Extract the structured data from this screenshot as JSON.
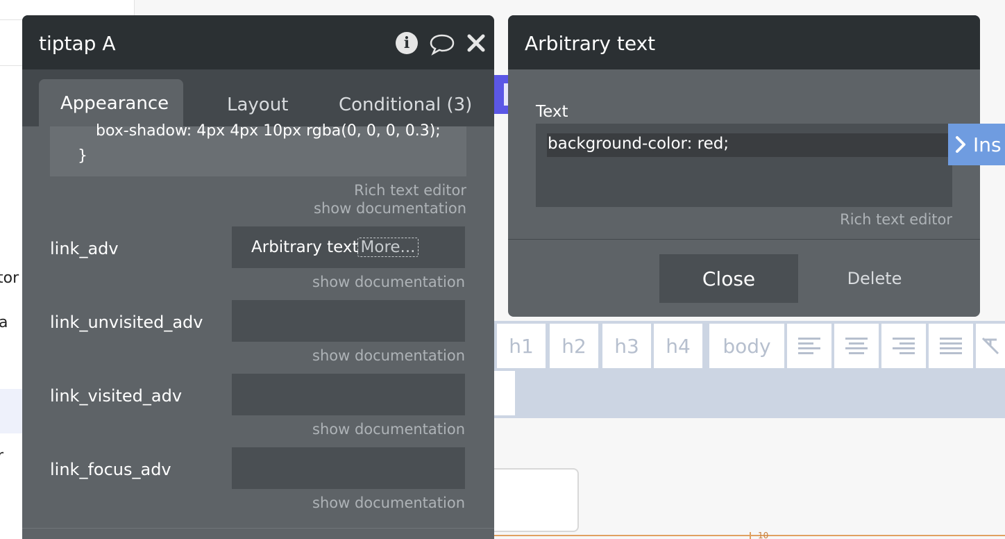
{
  "panel": {
    "title": "tiptap A",
    "tabs": [
      "Appearance",
      "Layout",
      "Conditional (3)"
    ],
    "code_lines": [
      "box-shadow: 4px 4px 10px rgba(0, 0, 0, 0.3);",
      "}"
    ],
    "code_hint_1": "Rich text editor",
    "code_hint_2": "show documentation",
    "fields": [
      {
        "label": "link_adv",
        "value": "Arbitrary text",
        "more": "More...",
        "hint": "show documentation"
      },
      {
        "label": "link_unvisited_adv",
        "value": "",
        "hint": "show documentation"
      },
      {
        "label": "link_visited_adv",
        "value": "",
        "hint": "show documentation"
      },
      {
        "label": "link_focus_adv",
        "value": "",
        "hint": "show documentation"
      }
    ]
  },
  "dialog": {
    "title": "Arbitrary text",
    "text_label": "Text",
    "text_value": "background-color: red;",
    "hint": "Rich text editor",
    "close_label": "Close",
    "delete_label": "Delete"
  },
  "insert_label": "Ins",
  "background": {
    "left_fragments": [
      "tor",
      "a",
      "r"
    ],
    "toolbar_buttons": [
      "h1",
      "h2",
      "h3",
      "h4",
      "body"
    ],
    "ruler_number": "10"
  },
  "colors": {
    "panel_bg": "#5e6367",
    "header_bg": "#2b3033",
    "input_bg": "#4a4f53",
    "accent_blue": "#6f9ce0",
    "purple": "#5b57e6",
    "toolbar_bg": "#ccd5e3"
  }
}
